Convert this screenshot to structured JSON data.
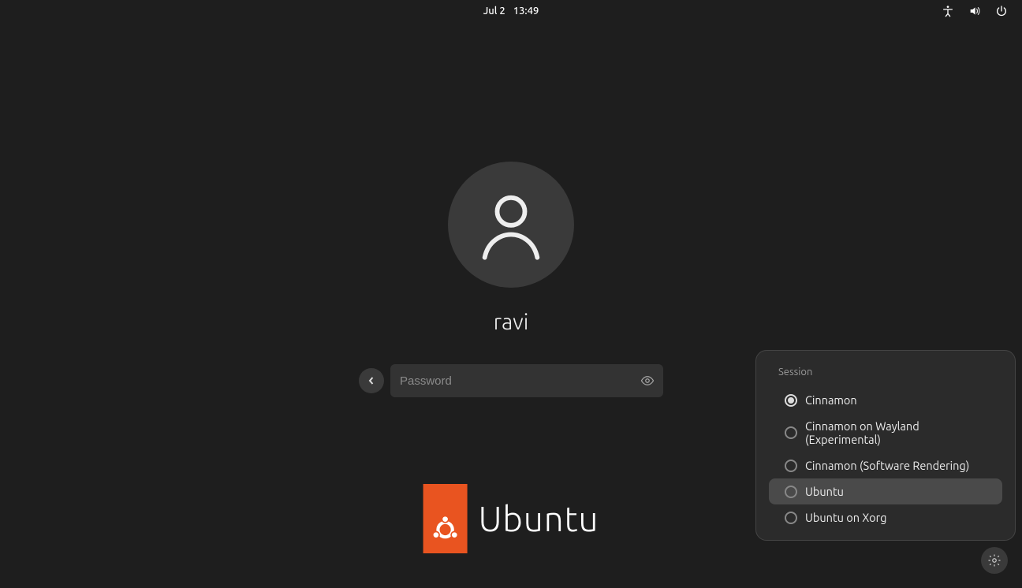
{
  "topbar": {
    "date": "Jul 2",
    "time": "13:49"
  },
  "login": {
    "username": "ravi",
    "password_placeholder": "Password"
  },
  "branding": {
    "word": "Ubuntu"
  },
  "session_menu": {
    "title": "Session",
    "selected_index": 0,
    "hovered_index": 3,
    "options": [
      "Cinnamon",
      "Cinnamon on Wayland (Experimental)",
      "Cinnamon (Software Rendering)",
      "Ubuntu",
      "Ubuntu on Xorg"
    ]
  }
}
